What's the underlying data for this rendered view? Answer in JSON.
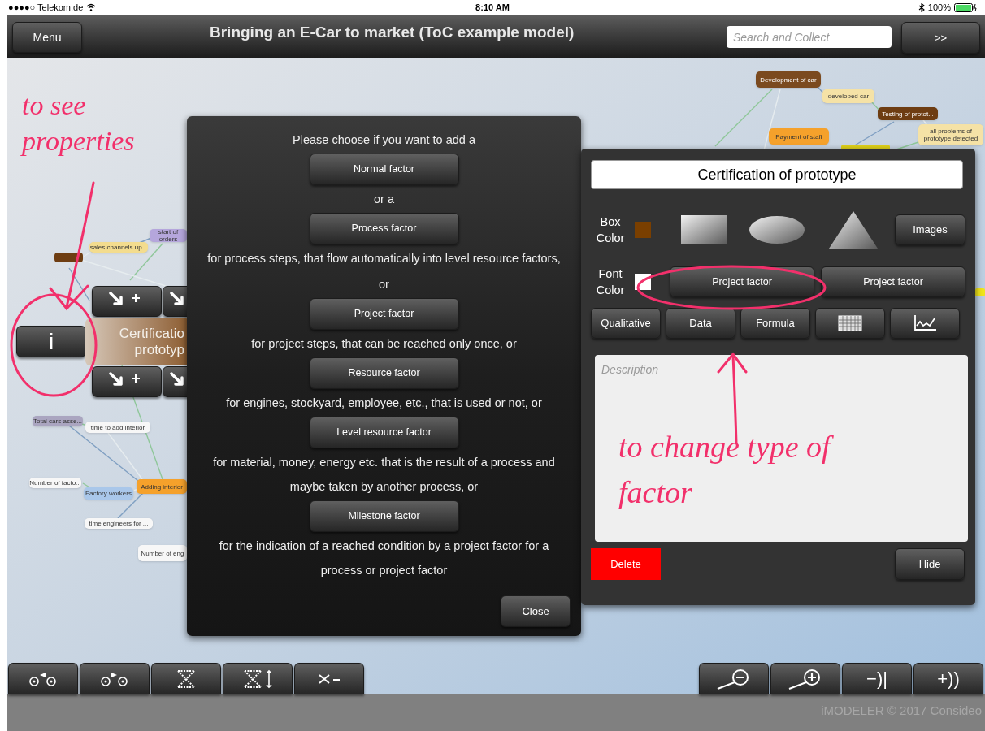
{
  "status_bar": {
    "carrier": "●●●●○ Telekom.de",
    "time": "8:10 AM",
    "battery": "100%"
  },
  "header": {
    "menu_button": "Menu",
    "title": "Bringing an E-Car to market (ToC example model)",
    "search": {
      "placeholder": "Search and Collect"
    },
    "next_button": ">>"
  },
  "canvas": {
    "nodes": [
      {
        "label": "Development of car",
        "color": "#7b4a1f"
      },
      {
        "label": "developed car",
        "color": "#f5e2a6"
      },
      {
        "label": "Testing of protot...",
        "color": "#6e3d12"
      },
      {
        "label": "Payment of staff",
        "color": "#f5a12b"
      },
      {
        "label": "all problems of prototype detected",
        "color": "#f5e2a6"
      },
      {
        "label": "sales channels up...",
        "color": "#f3dc8e"
      },
      {
        "label": "start of orders",
        "color": "#b5a6dc"
      },
      {
        "label": "Total cars asse...",
        "color": "#aaa5c0"
      },
      {
        "label": "time to add interior",
        "color": "#f7f7f7"
      },
      {
        "label": "Number of facto...",
        "color": "#f7f7f7"
      },
      {
        "label": "Factory workers",
        "color": "#a9c7ea"
      },
      {
        "label": "Adding interior",
        "color": "#f5a12b"
      },
      {
        "label": "time engineers for ...",
        "color": "#f7f7f7"
      },
      {
        "label": "Number of eng",
        "color": "#f7f7f7"
      }
    ],
    "selected_node": {
      "lines": [
        "Certificatio",
        "prototyp"
      ],
      "info_button": "i"
    },
    "annotations": [
      {
        "kind": "left",
        "text": "to see properties"
      },
      {
        "kind": "right",
        "text": "to change type of factor"
      }
    ]
  },
  "factor_dialog": {
    "items": [
      {
        "kind": "text",
        "text": "Please choose if you want to add a"
      },
      {
        "kind": "button",
        "text": "Normal factor"
      },
      {
        "kind": "text",
        "text": "or a"
      },
      {
        "kind": "button",
        "text": "Process factor"
      },
      {
        "kind": "text",
        "text": "for process steps, that flow automatically into level resource factors,"
      },
      {
        "kind": "text",
        "text": "or"
      },
      {
        "kind": "button",
        "text": "Project factor"
      },
      {
        "kind": "text",
        "text": "for project steps, that can be reached only once, or"
      },
      {
        "kind": "button",
        "text": "Resource factor"
      },
      {
        "kind": "text",
        "text": "for engines, stockyard, employee, etc., that is used or not, or"
      },
      {
        "kind": "button",
        "text": "Level resource factor"
      },
      {
        "kind": "text",
        "text": "for material, money, energy etc. that is the result of a process and maybe taken by another process, or"
      },
      {
        "kind": "button",
        "text": "Milestone factor"
      },
      {
        "kind": "text",
        "text": "for the indication of a reached condition by a project factor for a process or project factor"
      }
    ],
    "close_button": "Close"
  },
  "properties_panel": {
    "name": "Certification of prototype",
    "box_color": {
      "label": "Box Color",
      "color": "#7a3f00"
    },
    "images_button": "Images",
    "font_color": {
      "label": "Font Color",
      "color": "#ffffff"
    },
    "type_buttons": [
      "Project factor",
      "Project factor"
    ],
    "tab_buttons": [
      "Qualitative",
      "Data",
      "Formula"
    ],
    "description": {
      "placeholder": "Description"
    },
    "delete_button": "Delete",
    "hide_button": "Hide"
  },
  "toolbar": {
    "right_buttons": [
      "−)|",
      "+))"
    ]
  },
  "footer": "iMODELER © 2017 Consideo"
}
